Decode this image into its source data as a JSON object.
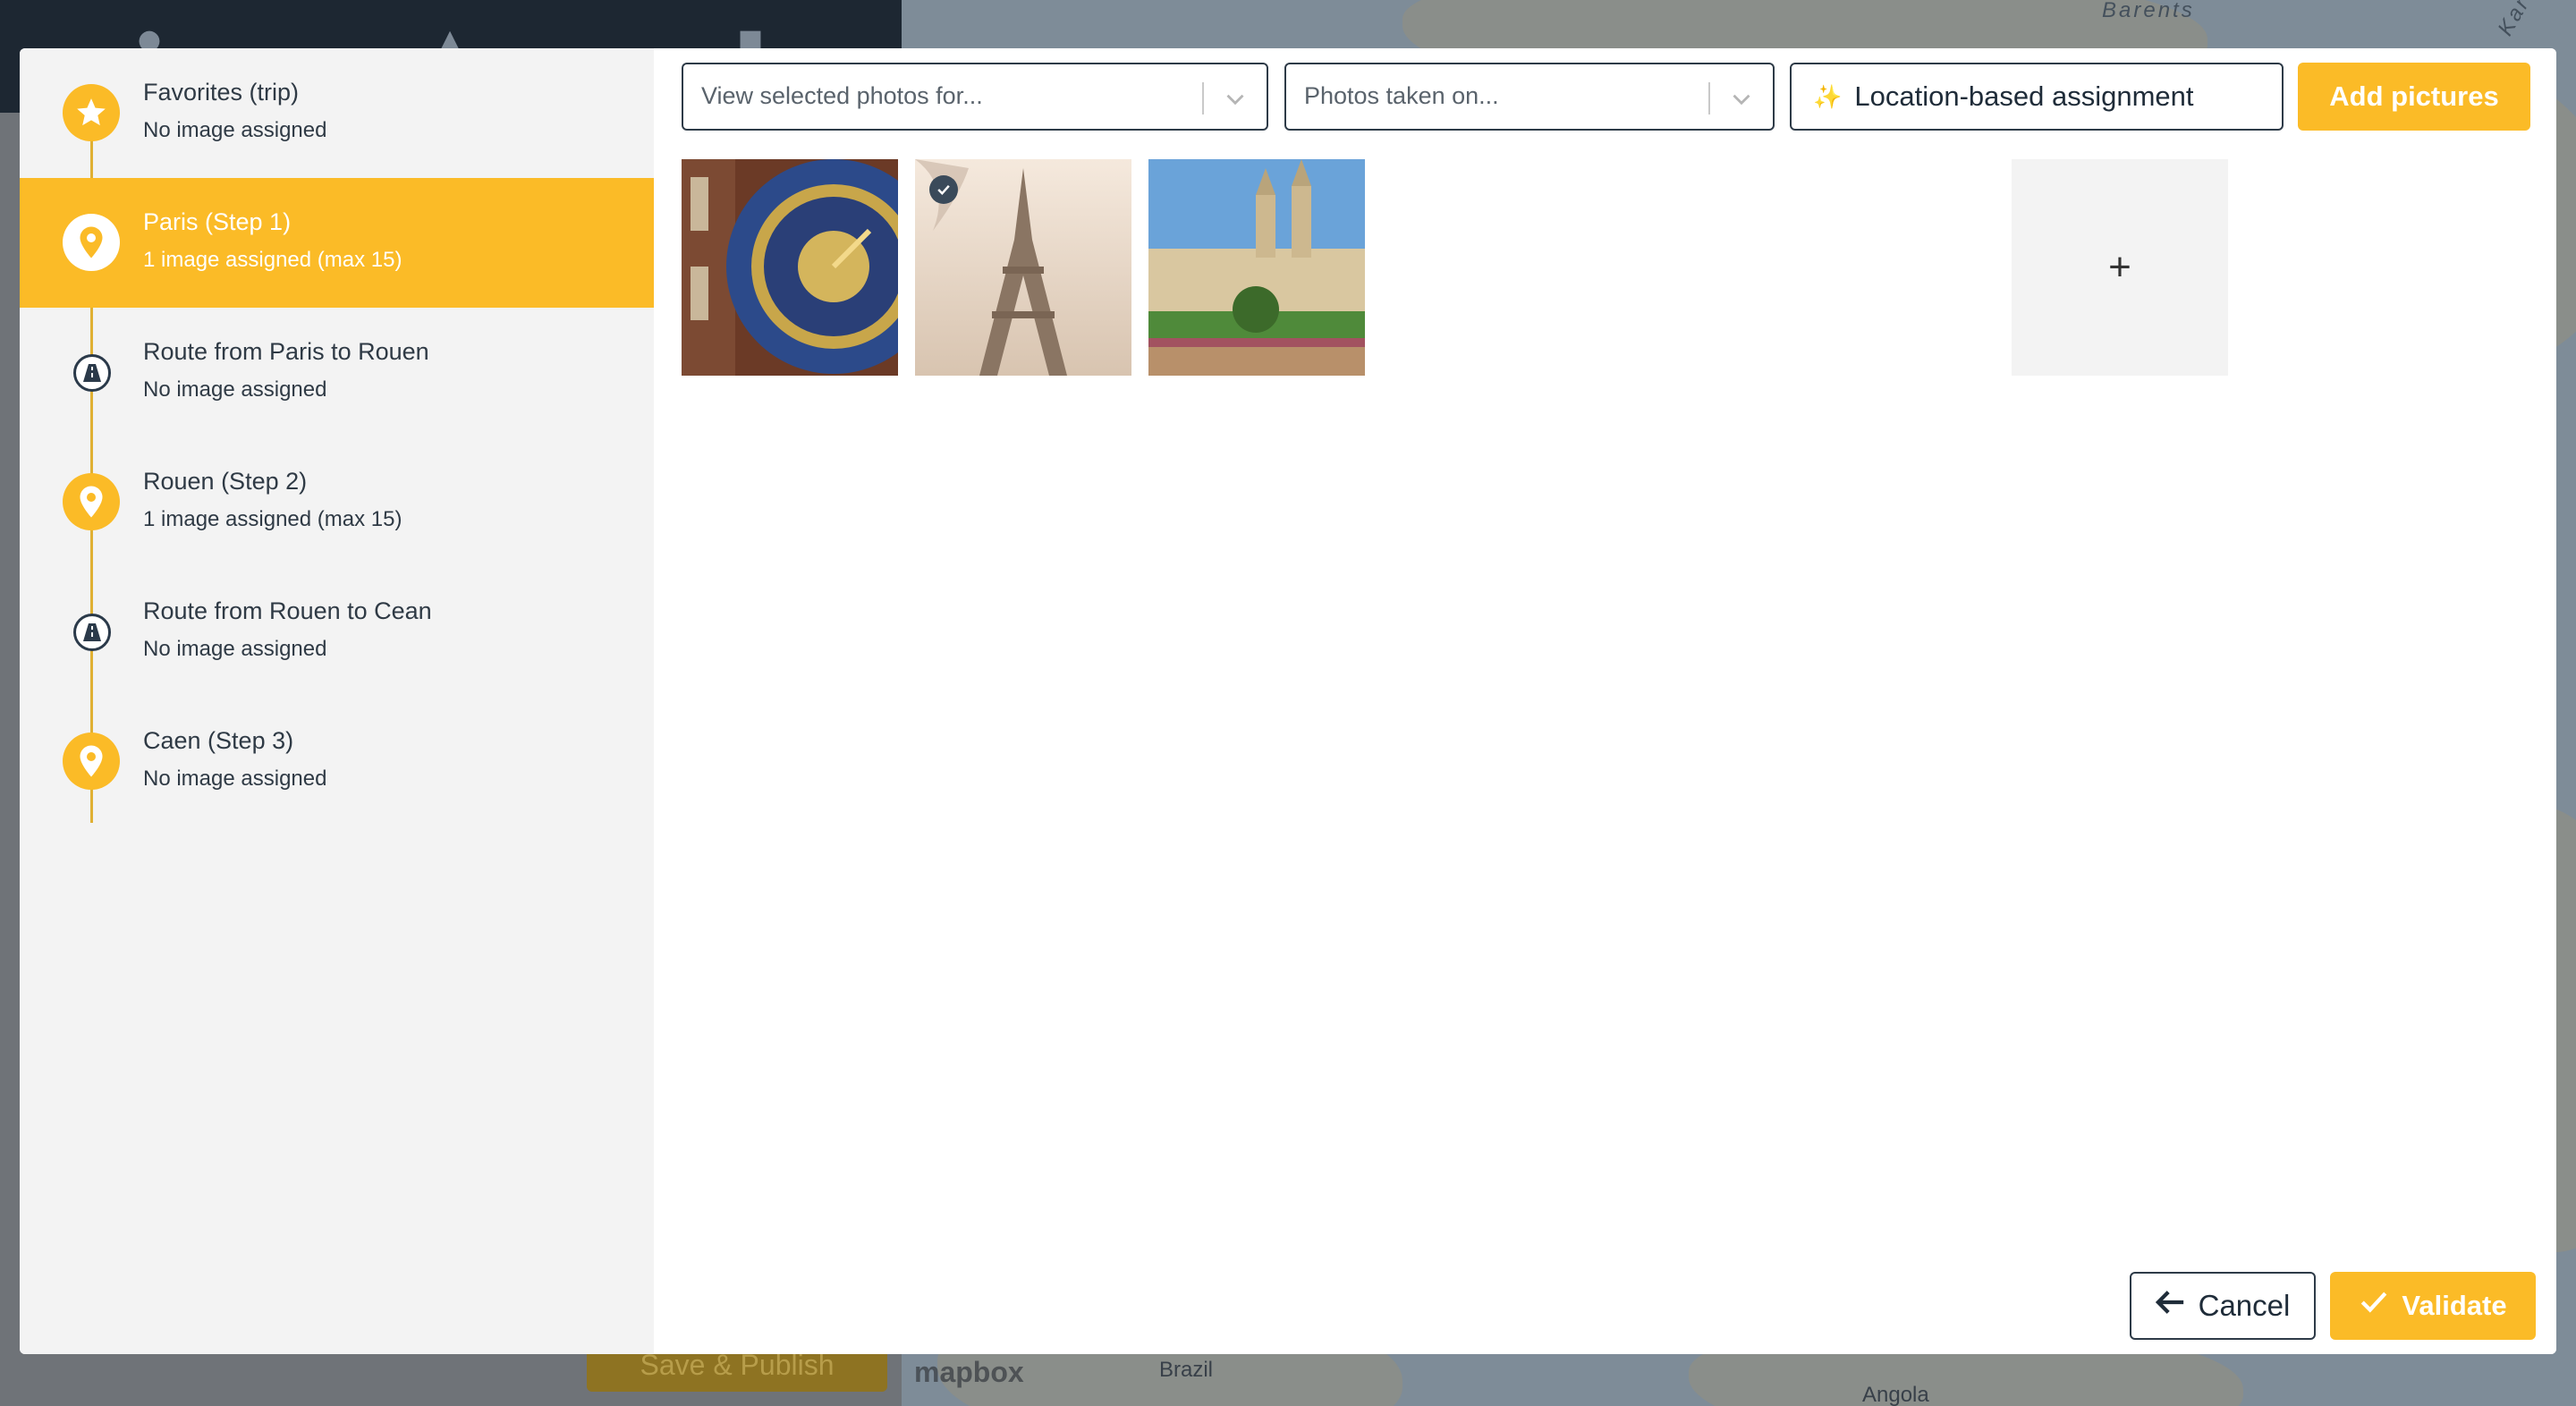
{
  "background": {
    "save_publish_label": "Save & Publish",
    "map_labels": {
      "barents": "Barents",
      "kara": "Kar",
      "brazil": "Brazil",
      "angola": "Angola",
      "mapbox": "mapbox"
    },
    "header_icons": [
      "globe-icon",
      "map-pin-icon",
      "camera-icon"
    ]
  },
  "sidebar": {
    "items": [
      {
        "title": "Favorites (trip)",
        "subtitle": "No image assigned",
        "icon": "star-icon",
        "active": false
      },
      {
        "title": "Paris (Step 1)",
        "subtitle": "1 image assigned (max 15)",
        "icon": "location-pin-icon",
        "active": true
      },
      {
        "title": "Route from Paris to Rouen",
        "subtitle": "No image assigned",
        "icon": "road-icon",
        "active": false
      },
      {
        "title": "Rouen (Step 2)",
        "subtitle": "1 image assigned (max 15)",
        "icon": "location-pin-icon",
        "active": false
      },
      {
        "title": "Route from Rouen to Cean",
        "subtitle": "No image assigned",
        "icon": "road-icon",
        "active": false
      },
      {
        "title": "Caen (Step 3)",
        "subtitle": "No image assigned",
        "icon": "location-pin-icon",
        "active": false
      }
    ]
  },
  "toolbar": {
    "view_select_placeholder": "View selected photos for...",
    "date_select_placeholder": "Photos taken on...",
    "location_button_label": "Location-based assignment",
    "location_button_icon": "sparkles-icon",
    "add_pictures_label": "Add pictures"
  },
  "photos": [
    {
      "subject": "Rouen Gros-Horloge clock",
      "selected": false
    },
    {
      "subject": "Eiffel Tower",
      "selected": true
    },
    {
      "subject": "Abbaye aux Hommes, Caen",
      "selected": false
    }
  ],
  "add_tile_label": "+",
  "footer": {
    "cancel_label": "Cancel",
    "validate_label": "Validate"
  },
  "colors": {
    "accent": "#fbbb27",
    "dark": "#2e3b48",
    "sidebar_bg": "#f3f3f3"
  }
}
